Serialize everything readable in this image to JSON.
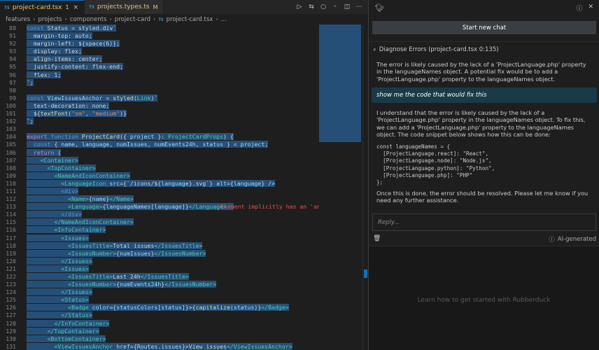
{
  "tabs": [
    {
      "lang": "TS",
      "name": "project-card.tsx",
      "badge": "1",
      "active": true
    },
    {
      "lang": "TS",
      "name": "projects.types.ts",
      "badge": "M",
      "active": false
    }
  ],
  "breadcrumb": [
    "features",
    "projects",
    "components",
    "project-card",
    "project-card.tsx",
    "..."
  ],
  "code_lines": [
    {
      "n": "88",
      "html": "<span class=\"hl\"><span class=\"k\">const</span> Status = styled.div`</span>"
    },
    {
      "n": "91",
      "html": "<span class=\"hl\">  margin-top: auto;</span>"
    },
    {
      "n": "92",
      "html": "<span class=\"hl\">  margin-left: ${space(6)};</span>"
    },
    {
      "n": "93",
      "html": "<span class=\"hl\">  display: flex;</span>"
    },
    {
      "n": "94",
      "html": "<span class=\"hl\">  align-items: center;</span>"
    },
    {
      "n": "95",
      "html": "<span class=\"hl\">  justify-content: flex-end;</span>"
    },
    {
      "n": "96",
      "html": "<span class=\"hl\">  flex: 1;</span>"
    },
    {
      "n": "97",
      "html": "<span class=\"hl\">`;</span>"
    },
    {
      "n": "98",
      "html": ""
    },
    {
      "n": "99",
      "html": "<span class=\"hl\"><span class=\"k\">const</span> <span class=\"v\">ViewIssuesAnchor</span> = <span class=\"f\">styled</span>(<span class=\"t\">Link</span>)`</span>"
    },
    {
      "n": "100",
      "html": "<span class=\"hl\">  text-decoration: none;</span>"
    },
    {
      "n": "101",
      "html": "<span class=\"hl\">  ${<span class=\"f\">textFont</span>(<span class=\"s\">\"sm\"</span>, <span class=\"s\">\"medium\"</span>)}</span>"
    },
    {
      "n": "102",
      "html": "<span class=\"hl\">`;</span>"
    },
    {
      "n": "103",
      "html": ""
    },
    {
      "n": "104",
      "html": "<span class=\"hl\"><span class=\"kw\">export</span> <span class=\"k\">function</span> <span class=\"f\">ProjectCard</span>({ <span class=\"v\">project</span> }: <span class=\"t\">ProjectCardProps</span>) {</span>"
    },
    {
      "n": "105",
      "html": "<span class=\"hl\">  <span class=\"k\">const</span> { <span class=\"v\">name</span>, <span class=\"v\">language</span>, <span class=\"v\">numIssues</span>, <span class=\"v\">numEvents24h</span>, <span class=\"v\">status</span> } = <span class=\"v\">project</span>;</span>"
    },
    {
      "n": "106",
      "html": "<span class=\"hl\">  <span class=\"kw\">return</span> (</span>"
    },
    {
      "n": "107",
      "html": "<span class=\"hl\">    <span class=\"t\">&lt;Container&gt;</span></span>"
    },
    {
      "n": "108",
      "html": "<span class=\"hl\">      <span class=\"t\">&lt;TopContainer&gt;</span></span>"
    },
    {
      "n": "109",
      "html": "<span class=\"hl\">        <span class=\"t\">&lt;NameAndIconContainer&gt;</span></span>"
    },
    {
      "n": "110",
      "html": "<span class=\"hl\">          <span class=\"t\">&lt;LanguageIcon</span> <span class=\"v\">src</span>={`/icons/${<span class=\"v\">language</span>}.svg`} <span class=\"v\">alt</span>={<span class=\"v\">language</span>} /&gt;</span>"
    },
    {
      "n": "111",
      "html": "<span class=\"hl\">          <span class=\"k\">&lt;div&gt;</span></span>"
    },
    {
      "n": "112",
      "html": "<span class=\"hl\">            <span class=\"t\">&lt;Name&gt;</span>{<span class=\"v\">name</span>}<span class=\"t\">&lt;/Name&gt;</span></span>"
    },
    {
      "n": "113",
      "html": "<span class=\"hl\">            <span class=\"t\">&lt;Language&gt;</span>{<span class=\"v\">languageNames</span>[<span class=\"v\">language</span>]}<span class=\"t\">&lt;/Language&gt;</span>  </span>"
    },
    {
      "n": "114",
      "html": "<span class=\"hl\">          <span class=\"k\">&lt;/div&gt;</span></span>"
    },
    {
      "n": "115",
      "html": "<span class=\"hl\">        <span class=\"t\">&lt;/NameAndIconContainer&gt;</span></span>"
    },
    {
      "n": "116",
      "html": "<span class=\"hl\">        <span class=\"t\">&lt;InfoContainer&gt;</span></span>"
    },
    {
      "n": "117",
      "html": "<span class=\"hl\">          <span class=\"t\">&lt;Issues&gt;</span></span>"
    },
    {
      "n": "118",
      "html": "<span class=\"hl\">            <span class=\"t\">&lt;IssuesTitle&gt;</span>Total issues<span class=\"t\">&lt;/IssuesTitle&gt;</span></span>"
    },
    {
      "n": "119",
      "html": "<span class=\"hl\">            <span class=\"t\">&lt;IssuesNumber&gt;</span>{<span class=\"v\">numIssues</span>}<span class=\"t\">&lt;/IssuesNumber&gt;</span></span>"
    },
    {
      "n": "120",
      "html": "<span class=\"hl\">          <span class=\"t\">&lt;/Issues&gt;</span></span>"
    },
    {
      "n": "121",
      "html": "<span class=\"hl\">          <span class=\"t\">&lt;Issues&gt;</span></span>"
    },
    {
      "n": "122",
      "html": "<span class=\"hl\">            <span class=\"t\">&lt;IssuesTitle&gt;</span>Last 24h<span class=\"t\">&lt;/IssuesTitle&gt;</span></span>"
    },
    {
      "n": "123",
      "html": "<span class=\"hl\">            <span class=\"t\">&lt;IssuesNumber&gt;</span>{<span class=\"v\">numEvents24h</span>}<span class=\"t\">&lt;/IssuesNumber&gt;</span></span>"
    },
    {
      "n": "124",
      "html": "<span class=\"hl\">          <span class=\"t\">&lt;/Issues&gt;</span></span>"
    },
    {
      "n": "125",
      "html": "<span class=\"hl\">          <span class=\"t\">&lt;Status&gt;</span></span>"
    },
    {
      "n": "126",
      "html": "<span class=\"hl\">            <span class=\"t\">&lt;Badge</span> <span class=\"v\">color</span>={<span class=\"v\">statusColors</span>[<span class=\"v\">status</span>]}&gt;{<span class=\"f\">capitalize</span>(<span class=\"v\">status</span>)}<span class=\"t\">&lt;/Badge&gt;</span></span>"
    },
    {
      "n": "127",
      "html": "<span class=\"hl\">          <span class=\"t\">&lt;/Status&gt;</span></span>"
    },
    {
      "n": "128",
      "html": "<span class=\"hl\">        <span class=\"t\">&lt;/InfoContainer&gt;</span></span>"
    },
    {
      "n": "129",
      "html": "<span class=\"hl\">      <span class=\"t\">&lt;/TopContainer&gt;</span></span>"
    },
    {
      "n": "130",
      "html": "<span class=\"hl\">      <span class=\"t\">&lt;BottomContainer&gt;</span></span>"
    },
    {
      "n": "131",
      "html": "<span class=\"hl\">        <span class=\"t\">&lt;ViewIssuesAnchor</span> <span class=\"v\">href</span>={<span class=\"v\">Routes</span>.<span class=\"v\">issues</span>}&gt;View issues<span class=\"t\">&lt;/ViewIssuesAnchor&gt;</span></span>"
    }
  ],
  "inline_error": {
    "line": "113",
    "text": "Element implicitly has an 'any'"
  },
  "panel": {
    "new_chat": "Start new chat",
    "conversation_title": "Diagnose Errors (project-card.tsx 0:135)",
    "bot_msg_1": "The error is likely caused by the lack of a 'ProjectLanguage.php' property in the languageNames object. A potential fix would be to add a 'ProjectLanguage.php' property to the languageNames object.",
    "user_msg": "show me the code that would fix this",
    "bot_msg_2": "I understand that the error is likely caused by the lack of a 'ProjectLanguage.php' property in the languageNames object. To fix this, we can add a 'ProjectLanguage.php' property to the languageNames object. The code snippet below shows how this can be done:",
    "snippet": "const languageNames = {\n  [ProjectLanguage.react]: \"React\",\n  [ProjectLanguage.node]: \"Node.js\",\n  [ProjectLanguage.python]: \"Python\",\n  [ProjectLanguage.php]: \"PHP\"\n};",
    "bot_msg_3": "Once this is done, the error should be resolved. Please let me know if you need any further assistance.",
    "reply_placeholder": "Reply...",
    "ai_generated": "AI-generated",
    "get_started": "Learn how to get started with Rubberduck"
  },
  "colors": {
    "accent": "#0e70c0",
    "selection": "#264f78",
    "error": "#f14c4c",
    "user_bubble": "#1a3a47"
  },
  "icons": [
    "run-icon",
    "compare-icon",
    "circle-icon",
    "split-editor-icon",
    "more-icon",
    "duck-icon",
    "help-icon",
    "close-icon",
    "chat-icon",
    "trash-icon",
    "info-icon"
  ]
}
